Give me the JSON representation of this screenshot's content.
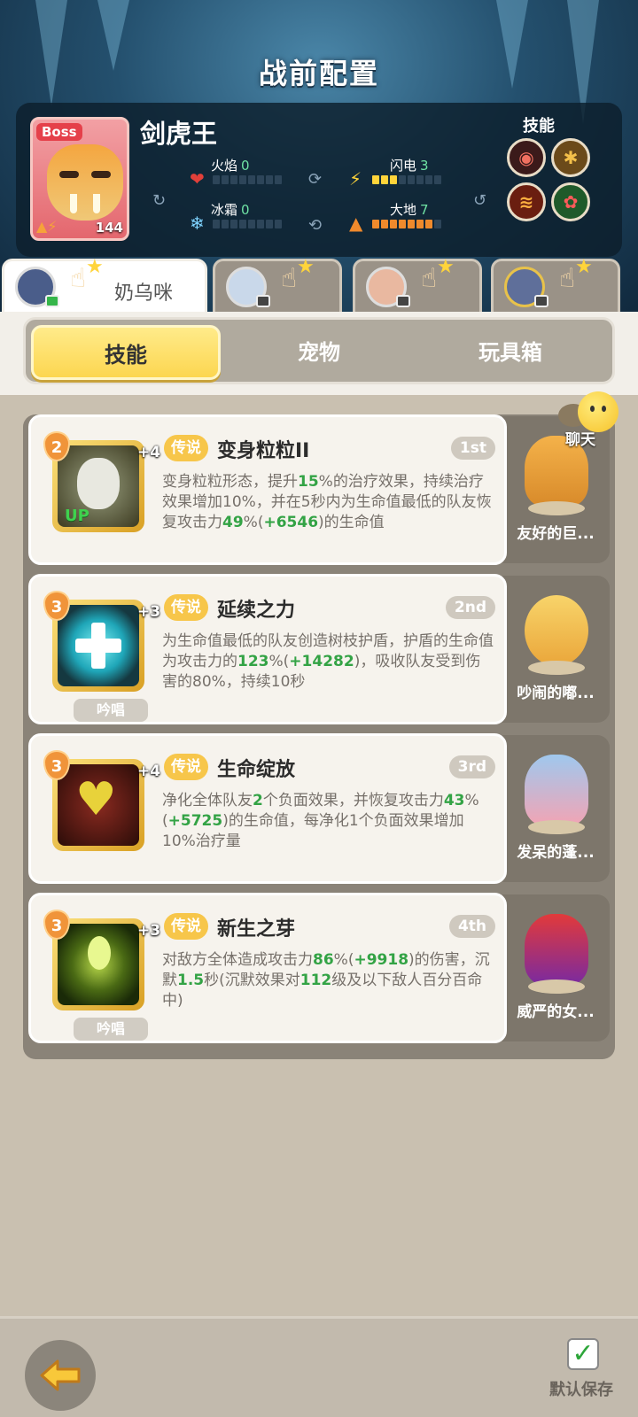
{
  "header": {
    "title": "战前配置"
  },
  "boss": {
    "tag": "Boss",
    "name": "剑虎王",
    "level": "144",
    "skills_label": "技能",
    "stats": [
      {
        "label": "火焰",
        "value": "0",
        "filled": 0,
        "max": 8,
        "icon": "fire-icon"
      },
      {
        "label": "闪电",
        "value": "3",
        "filled": 3,
        "max": 8,
        "icon": "lightning-icon"
      },
      {
        "label": "冰霜",
        "value": "0",
        "filled": 0,
        "max": 8,
        "icon": "snowflake-icon"
      },
      {
        "label": "大地",
        "value": "7",
        "filled": 7,
        "max": 8,
        "icon": "earth-icon"
      }
    ],
    "skill_icons": [
      "bite-icon",
      "claw-beast-icon",
      "fire-slash-icon",
      "heal-plant-icon"
    ]
  },
  "heroes": [
    {
      "name": "奶乌咪",
      "active": true,
      "avatar": "hero-avatar-robot"
    },
    {
      "name": "",
      "active": false,
      "avatar": "hero-avatar-silver-hair"
    },
    {
      "name": "",
      "active": false,
      "avatar": "hero-avatar-red-hair"
    },
    {
      "name": "",
      "active": false,
      "avatar": "hero-avatar-robot-2"
    }
  ],
  "subtabs": [
    "技能",
    "宠物",
    "玩具箱"
  ],
  "chat": {
    "label": "聊天"
  },
  "skills": [
    {
      "level": "2",
      "plus": "+4",
      "rarity": "传说",
      "title": "变身粒粒II",
      "rank": "1st",
      "badge": "UP",
      "chant": "",
      "desc": [
        {
          "t": "变身粒粒形态，提升"
        },
        {
          "t": "15",
          "g": true
        },
        {
          "t": "%的治疗效果，持续治疗效果增加10%，并在5秒内为生命值最低的队友恢复攻击力"
        },
        {
          "t": "49",
          "g": true
        },
        {
          "t": "%("
        },
        {
          "t": "+6546",
          "g": true
        },
        {
          "t": ")的生命值"
        }
      ],
      "pet": "友好的巨..."
    },
    {
      "level": "3",
      "plus": "+3",
      "rarity": "传说",
      "title": "延续之力",
      "rank": "2nd",
      "badge": "",
      "chant": "吟唱",
      "desc": [
        {
          "t": "为生命值最低的队友创造树枝护盾，护盾的生命值为攻击力的"
        },
        {
          "t": "123",
          "g": true
        },
        {
          "t": "%("
        },
        {
          "t": "+14282",
          "g": true
        },
        {
          "t": ")，吸收队友受到伤害的80%，持续10秒"
        }
      ],
      "pet": "吵闹的嘟..."
    },
    {
      "level": "3",
      "plus": "+4",
      "rarity": "传说",
      "title": "生命绽放",
      "rank": "3rd",
      "badge": "",
      "chant": "",
      "desc": [
        {
          "t": "净化全体队友"
        },
        {
          "t": "2",
          "g": true
        },
        {
          "t": "个负面效果，并恢复攻击力"
        },
        {
          "t": "43",
          "g": true
        },
        {
          "t": "%("
        },
        {
          "t": "+5725",
          "g": true
        },
        {
          "t": ")的生命值，每净化1个负面效果增加10%治疗量"
        }
      ],
      "pet": "发呆的蓬..."
    },
    {
      "level": "3",
      "plus": "+3",
      "rarity": "传说",
      "title": "新生之芽",
      "rank": "4th",
      "badge": "",
      "chant": "吟唱",
      "desc": [
        {
          "t": "对敌方全体造成攻击力"
        },
        {
          "t": "86",
          "g": true
        },
        {
          "t": "%("
        },
        {
          "t": "+9918",
          "g": true
        },
        {
          "t": ")的伤害，沉默"
        },
        {
          "t": "1.5",
          "g": true
        },
        {
          "t": "秒(沉默效果对"
        },
        {
          "t": "112",
          "g": true
        },
        {
          "t": "级及以下敌人百分百命中)"
        }
      ],
      "pet": "威严的女..."
    }
  ],
  "footer": {
    "save_label": "默认保存"
  },
  "colors": {
    "accent_yellow": "#fcd650",
    "value_green": "#33a345",
    "stat_green": "#6fe2a4"
  }
}
